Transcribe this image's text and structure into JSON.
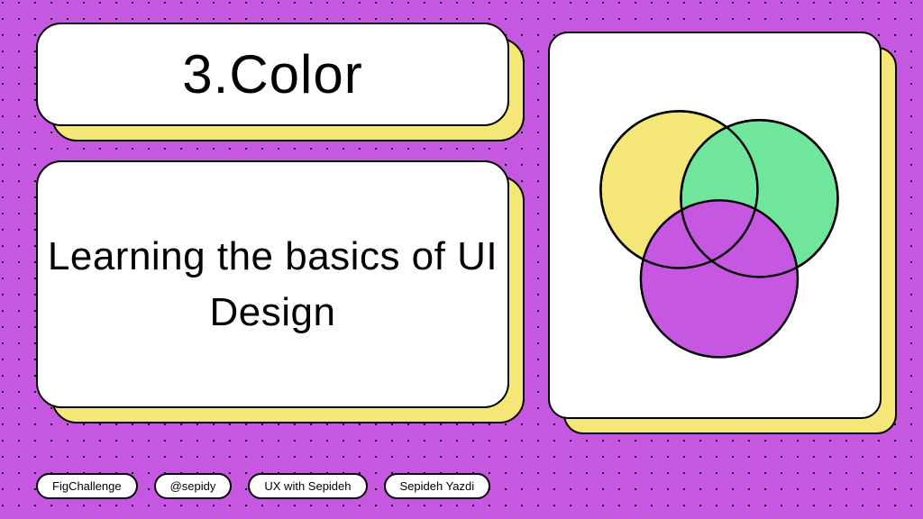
{
  "title": "3.Color",
  "subtitle": "Learning the basics of UI Design",
  "pills": [
    "FigChallenge",
    "@sepidy",
    "UX with Sepideh",
    "Sepideh Yazdi"
  ],
  "colors": {
    "background": "#c657e0",
    "accent": "#f5e678",
    "circle_yellow": "#f5e678",
    "circle_green": "#6fe69b",
    "circle_purple": "#c657e0"
  }
}
